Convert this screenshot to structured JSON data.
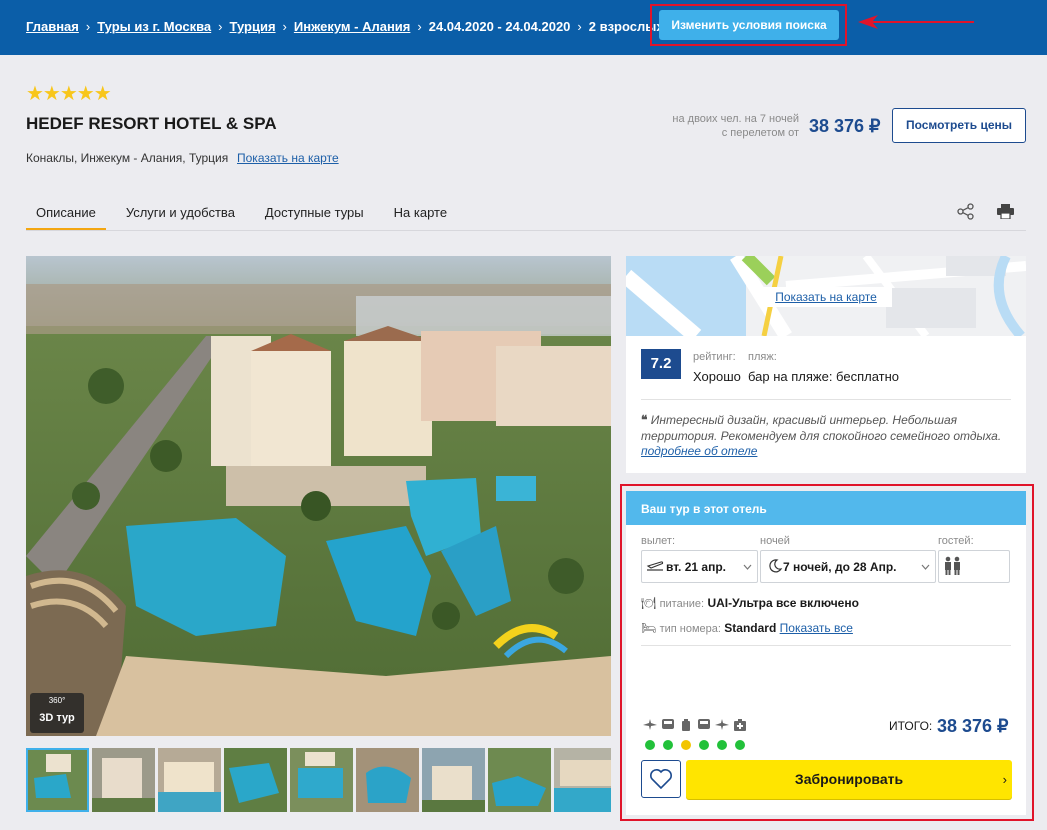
{
  "breadcrumbs": [
    {
      "label": "Главная",
      "link": true
    },
    {
      "label": "Туры из г. Москва",
      "link": true
    },
    {
      "label": "Турция",
      "link": true
    },
    {
      "label": "Инжекум - Алания",
      "link": true
    },
    {
      "label": "24.04.2020 - 24.04.2020",
      "link": false
    },
    {
      "label": "2 взрослых",
      "link": false
    }
  ],
  "search": {
    "change_label": "Изменить условия поиска"
  },
  "hotel": {
    "stars": "★★★★★",
    "name": "HEDEF RESORT HOTEL & SPA",
    "location": "Конаклы, Инжекум - Алания, Турция",
    "map_link": "Показать на карте"
  },
  "price_box": {
    "note_line1": "на двоих чел. на 7 ночей",
    "note_line2": "с перелетом от",
    "price": "38 376 ₽",
    "button": "Посмотреть цены"
  },
  "tabs": [
    {
      "label": "Описание",
      "active": true
    },
    {
      "label": "Услуги и удобства",
      "active": false
    },
    {
      "label": "Доступные туры",
      "active": false
    },
    {
      "label": "На карте",
      "active": false
    }
  ],
  "icons": {
    "share": "share-icon",
    "print": "print-icon",
    "tour3d": "360-icon"
  },
  "gallery": {
    "badge_deg": "360°",
    "badge_label": "3D тур",
    "thumbnail_count": 9
  },
  "map_card": {
    "button": "Показать на карте"
  },
  "rating": {
    "score": "7.2",
    "rating_label": "рейтинг:",
    "rating_value": "Хорошо",
    "beach_label": "пляж:",
    "beach_value": "бар на пляже: бесплатно",
    "review": "Интересный дизайн, красивый интерьер. Небольшая территория. Рекомендуем для спокойного семейного отдыха.",
    "more_link": "подробнее об отеле"
  },
  "tour": {
    "title": "Ваш тур в этот отель",
    "departure_label": "вылет:",
    "departure_value": "вт. 21 апр.",
    "nights_label": "ночей",
    "nights_value": "7 ночей, до 28 Апр.",
    "guests_label": "гостей:",
    "meal_label": "питание:",
    "meal_value": "UAI-Ультра все включено",
    "room_label": "тип номера:",
    "room_value": "Standard",
    "room_link": "Показать все",
    "services": [
      {
        "icon": "plane-icon",
        "status": "green"
      },
      {
        "icon": "bus-icon",
        "status": "green"
      },
      {
        "icon": "luggage-icon",
        "status": "yellow"
      },
      {
        "icon": "bus-icon",
        "status": "green"
      },
      {
        "icon": "plane-icon",
        "status": "green"
      },
      {
        "icon": "medical-kit-icon",
        "status": "green"
      }
    ],
    "total_label": "ИТОГО:",
    "total_value": "38 376 ₽",
    "book_label": "Забронировать"
  },
  "colors": {
    "topbar": "#0b5ea8",
    "accent_blue": "#1d4b8f",
    "link": "#1d5fa8",
    "button_light_blue": "#3fb0ea",
    "book_yellow": "#ffe500",
    "highlight_red": "#e0142a",
    "tab_active": "#f3a611",
    "status_green": "#22c13a",
    "status_yellow": "#f2c500"
  }
}
